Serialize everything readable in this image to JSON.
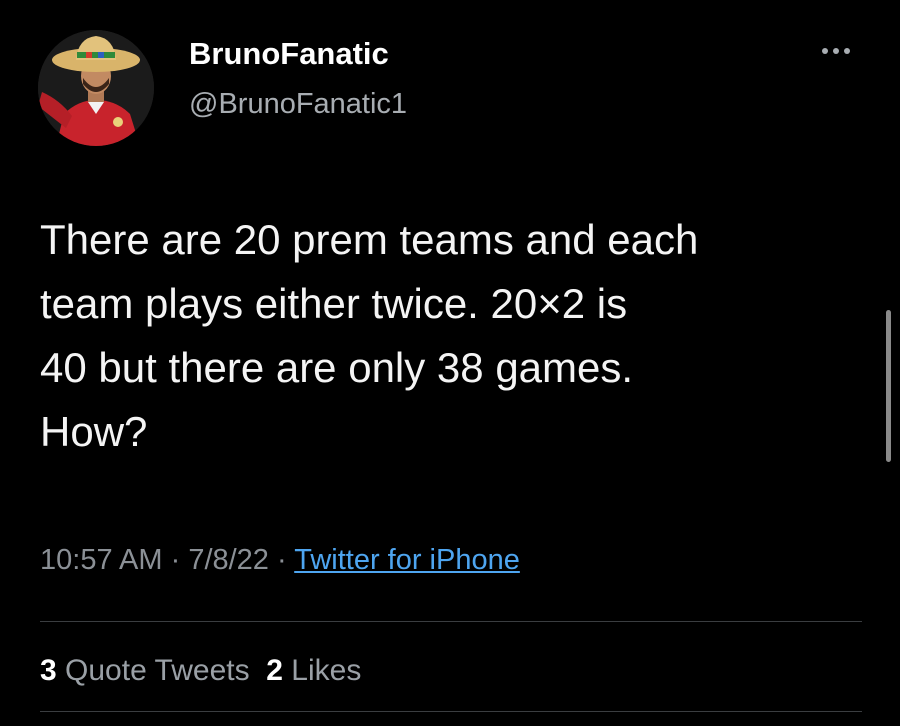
{
  "tweet": {
    "author": {
      "display_name": "BrunoFanatic",
      "handle": "@BrunoFanatic1",
      "avatar_icon": "profile-photo"
    },
    "more_icon": "more-options-icon",
    "text_lines": [
      "There are 20 prem teams and each",
      "team plays either twice. 20×2 is",
      "40 but there are only 38 games.",
      "How?"
    ],
    "meta": {
      "time": "10:57 AM",
      "separator": " · ",
      "date": "7/8/22",
      "source": "Twitter for iPhone"
    },
    "stats": {
      "quote_tweets_count": "3",
      "quote_tweets_label": "Quote Tweets",
      "likes_count": "2",
      "likes_label": "Likes"
    }
  },
  "colors": {
    "background": "#000000",
    "text": "#f4f4f4",
    "secondary": "#8b9096",
    "link": "#4ea5f0"
  }
}
